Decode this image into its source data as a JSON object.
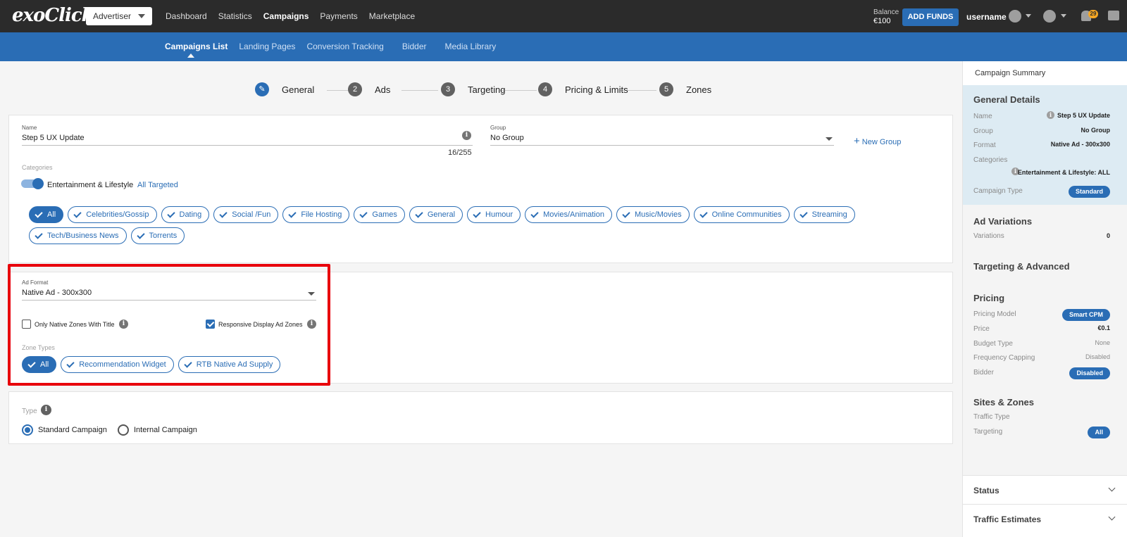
{
  "app": {
    "logo": "exoClick",
    "role": "Advertiser",
    "nav": [
      "Dashboard",
      "Statistics",
      "Campaigns",
      "Payments",
      "Marketplace"
    ],
    "active_nav": "Campaigns",
    "balance_label": "Balance",
    "balance_value": "€100",
    "add_funds": "ADD FUNDS",
    "username": "username",
    "notifications": "29"
  },
  "subnav": [
    "Campaigns List",
    "Landing Pages",
    "Conversion Tracking",
    "Bidder",
    "Media Library"
  ],
  "steps": [
    {
      "num": "✎",
      "label": "General"
    },
    {
      "num": "2",
      "label": "Ads"
    },
    {
      "num": "3",
      "label": "Targeting"
    },
    {
      "num": "4",
      "label": "Pricing & Limits"
    },
    {
      "num": "5",
      "label": "Zones"
    }
  ],
  "general": {
    "name_label": "Name",
    "name_value": "Step 5 UX Update",
    "name_counter": "16/255",
    "group_label": "Group",
    "group_value": "No Group",
    "new_group": "New Group",
    "categories_label": "Categories",
    "category_toggle_label": "Entertainment & Lifestyle",
    "all_targeted": "All Targeted",
    "category_chips": [
      "All",
      "Celebrities/Gossip",
      "Dating",
      "Social /Fun",
      "File Hosting",
      "Games",
      "General",
      "Humour",
      "Movies/Animation",
      "Music/Movies",
      "Online Communities",
      "Streaming",
      "Tech/Business News",
      "Torrents"
    ]
  },
  "ad_format": {
    "label": "Ad Format",
    "value": "Native Ad - 300x300",
    "only_native_title": "Only Native Zones With Title",
    "responsive_display": "Responsive Display Ad Zones",
    "zone_types_label": "Zone Types",
    "zone_chips": [
      "All",
      "Recommendation Widget",
      "RTB Native Ad Supply"
    ]
  },
  "type": {
    "label": "Type",
    "standard": "Standard Campaign",
    "internal": "Internal Campaign"
  },
  "summary": {
    "header": "Campaign Summary",
    "general_title": "General Details",
    "name_key": "Name",
    "name_val": "Step 5 UX Update",
    "group_key": "Group",
    "group_val": "No Group",
    "format_key": "Format",
    "format_val": "Native Ad - 300x300",
    "categories_key": "Categories",
    "categories_val": "Entertainment & Lifestyle: ALL",
    "ctype_key": "Campaign Type",
    "ctype_val": "Standard",
    "adv_title": "Ad Variations",
    "variations_key": "Variations",
    "variations_val": "0",
    "targeting_title": "Targeting & Advanced",
    "pricing_title": "Pricing",
    "pmodel_key": "Pricing Model",
    "pmodel_val": "Smart CPM",
    "price_key": "Price",
    "price_val": "€0.1",
    "budget_key": "Budget Type",
    "budget_val": "None",
    "freq_key": "Frequency Capping",
    "freq_val": "Disabled",
    "bidder_key": "Bidder",
    "bidder_val": "Disabled",
    "sites_title": "Sites & Zones",
    "traffic_key": "Traffic Type",
    "targeting_key": "Targeting",
    "targeting_val": "All",
    "status": "Status",
    "traffic_estimates": "Traffic Estimates"
  },
  "colors": {
    "accent": "#2a6db5",
    "topbar": "#2b2b2b",
    "highlight": "#e8000b"
  }
}
